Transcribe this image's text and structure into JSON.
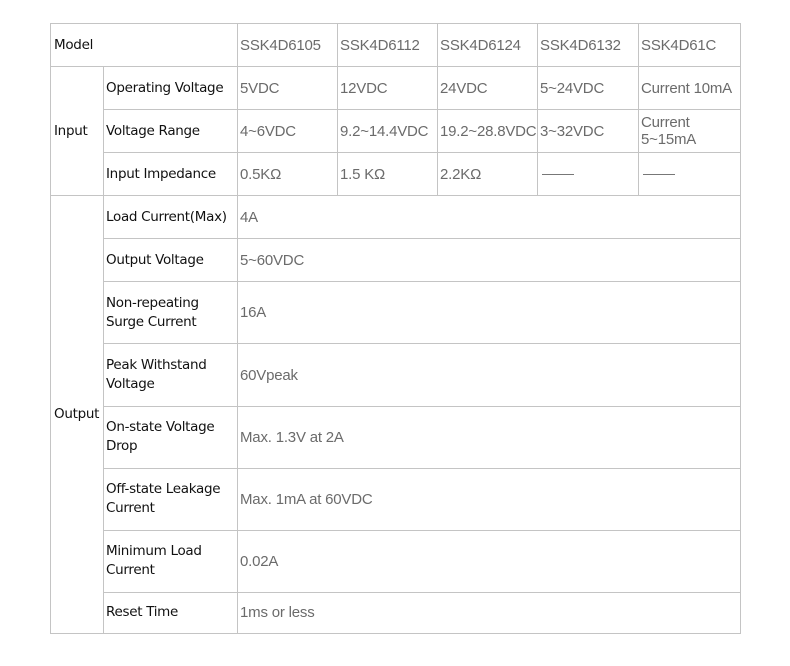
{
  "header": {
    "label": "Model",
    "models": [
      "SSK4D6105",
      "SSK4D6112",
      "SSK4D6124",
      "SSK4D6132",
      "SSK4D61C"
    ]
  },
  "input": {
    "group_label": "Input",
    "rows": [
      {
        "label": "Operating Voltage",
        "values": [
          "5VDC",
          "12VDC",
          "24VDC",
          "5~24VDC",
          "Current 10mA"
        ]
      },
      {
        "label": "Voltage Range",
        "values": [
          "4~6VDC",
          "9.2~14.4VDC",
          "19.2~28.8VDC",
          "3~32VDC"
        ],
        "last_line1": "Current",
        "last_line2": "5~15mA"
      },
      {
        "label": "Input Impedance",
        "values": [
          "0.5KΩ",
          "1.5 KΩ",
          "2.2KΩ"
        ]
      }
    ]
  },
  "output": {
    "group_label": "Output",
    "rows": [
      {
        "label_line1": "Load Current(Max)",
        "value": "4A"
      },
      {
        "label_line1": "Output Voltage",
        "value": "5~60VDC"
      },
      {
        "label_line1": "Non-repeating",
        "label_line2": "Surge Current",
        "value": "16A"
      },
      {
        "label_line1": "Peak Withstand",
        "label_line2": "Voltage",
        "value": "60Vpeak"
      },
      {
        "label_line1": "On-state Voltage",
        "label_line2": "Drop",
        "value": "Max. 1.3V at 2A"
      },
      {
        "label_line1": "Off-state Leakage",
        "label_line2": "Current",
        "value": "Max. 1mA at 60VDC"
      },
      {
        "label_line1": "Minimum Load",
        "label_line2": "Current",
        "value": "0.02A"
      },
      {
        "label_line1": "Reset Time",
        "value": "1ms or less"
      }
    ]
  }
}
